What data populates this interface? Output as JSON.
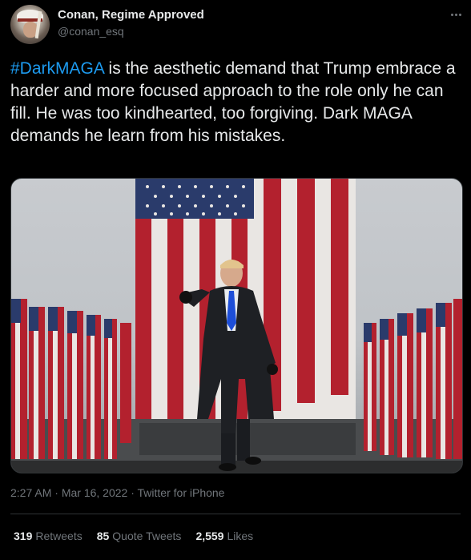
{
  "author": {
    "display_name": "Conan, Regime Approved",
    "handle": "@conan_esq"
  },
  "tweet": {
    "hashtag": "#DarkMAGA",
    "text_rest": " is the aesthetic demand that Trump embrace a harder and more focused approach to the role only he can fill. He was too kindhearted, too forgiving. Dark MAGA demands he learn from his mistakes."
  },
  "meta": {
    "time": "2:27 AM",
    "separator": " · ",
    "date": "Mar 16, 2022",
    "source": "Twitter for iPhone"
  },
  "stats": {
    "retweets_count": "319",
    "retweets_label": "Retweets",
    "quotes_count": "85",
    "quotes_label": "Quote Tweets",
    "likes_count": "2,559",
    "likes_label": "Likes"
  },
  "icons": {
    "more": "more-icon"
  },
  "colors": {
    "background": "#000000",
    "hashtag": "#1d9bf0",
    "secondary_text": "#71767b",
    "divider": "#2f3336"
  }
}
